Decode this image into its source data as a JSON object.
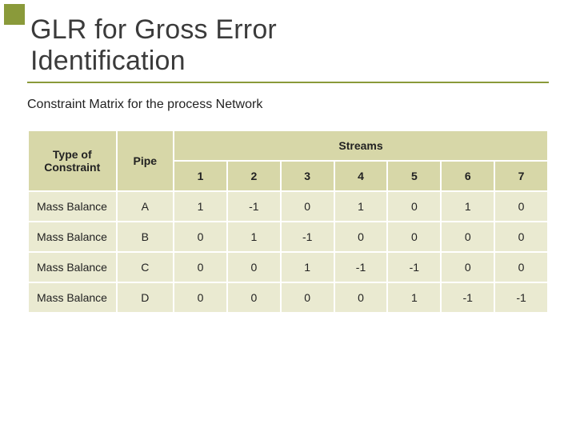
{
  "title_line1": "GLR for Gross Error",
  "title_line2": "Identification",
  "subtitle": "Constraint Matrix for the process Network",
  "header": {
    "type_of_constraint": "Type of Constraint",
    "pipe": "Pipe",
    "streams_label": "Streams",
    "streams": [
      "1",
      "2",
      "3",
      "4",
      "5",
      "6",
      "7"
    ]
  },
  "rows": [
    {
      "type": "Mass Balance",
      "pipe": "A",
      "vals": [
        "1",
        "-1",
        "0",
        "1",
        "0",
        "1",
        "0"
      ]
    },
    {
      "type": "Mass Balance",
      "pipe": "B",
      "vals": [
        "0",
        "1",
        "-1",
        "0",
        "0",
        "0",
        "0"
      ]
    },
    {
      "type": "Mass Balance",
      "pipe": "C",
      "vals": [
        "0",
        "0",
        "1",
        "-1",
        "-1",
        "0",
        "0"
      ]
    },
    {
      "type": "Mass Balance",
      "pipe": "D",
      "vals": [
        "0",
        "0",
        "0",
        "0",
        "1",
        "-1",
        "-1"
      ]
    }
  ],
  "chart_data": {
    "type": "table",
    "title": "Constraint Matrix for the process Network",
    "columns": [
      "Type of Constraint",
      "Pipe",
      "1",
      "2",
      "3",
      "4",
      "5",
      "6",
      "7"
    ],
    "rows": [
      [
        "Mass Balance",
        "A",
        1,
        -1,
        0,
        1,
        0,
        1,
        0
      ],
      [
        "Mass Balance",
        "B",
        0,
        1,
        -1,
        0,
        0,
        0,
        0
      ],
      [
        "Mass Balance",
        "C",
        0,
        0,
        1,
        -1,
        -1,
        0,
        0
      ],
      [
        "Mass Balance",
        "D",
        0,
        0,
        0,
        0,
        1,
        -1,
        -1
      ]
    ]
  }
}
